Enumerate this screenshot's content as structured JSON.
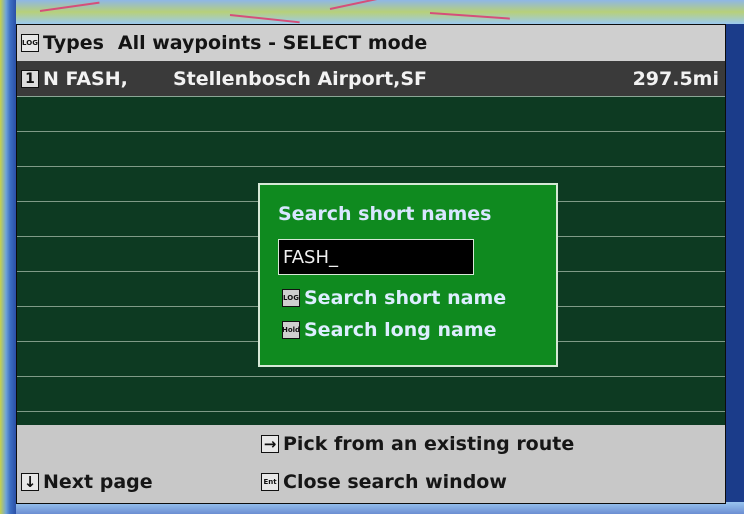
{
  "title_bar": {
    "types_key_icon": "LOG",
    "types_label": "Types",
    "mode_title": "All waypoints - SELECT mode"
  },
  "list": {
    "rows": [
      {
        "index": "1",
        "code": "N FASH,",
        "name": "Stellenbosch Airport,SF",
        "distance": "297.5mi"
      }
    ]
  },
  "search_dialog": {
    "title": "Search short names",
    "input_value": "FASH_",
    "options": [
      {
        "key_icon": "LOG",
        "label": "Search short name"
      },
      {
        "key_icon": "Hold",
        "label": "Search long name"
      }
    ]
  },
  "bottom_bar": {
    "pick_route": {
      "key_icon": "right-arrow-icon",
      "label": "Pick from an existing route"
    },
    "next_page": {
      "key_icon": "down-arrow-icon",
      "label": "Next page"
    },
    "close_search": {
      "key_icon": "Ent",
      "label": "Close search window"
    }
  },
  "colors": {
    "window_bg": "#0d3a22",
    "title_bar_bg": "#cfcfcf",
    "dialog_bg": "#0f8a1f",
    "selected_row_bg": "#3a3a3a"
  }
}
